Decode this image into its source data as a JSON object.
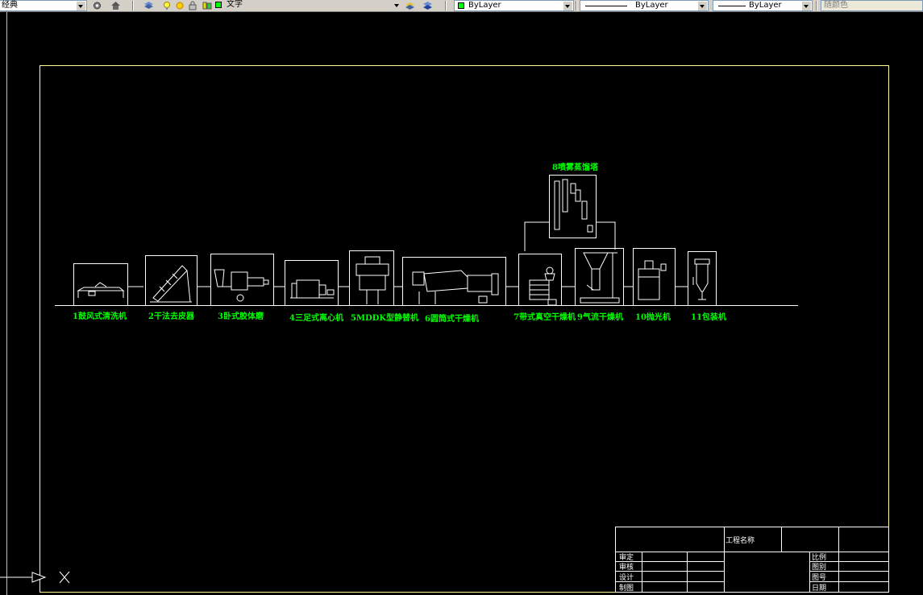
{
  "toolbar": {
    "style_combo": "经典",
    "text_style_combo": "文字",
    "color_combo": "ByLayer",
    "color_swatch": "#00ff00",
    "linetype_combo": "ByLayer",
    "lineweight_combo": "ByLayer",
    "plotstyle_combo": "随颜色",
    "icons": [
      "workspace-settings-icon",
      "workspace-home-icon",
      "layer-manager-icon",
      "layer-on-bulb-icon",
      "layer-freeze-sun-icon",
      "layer-lock-icon",
      "layer-color-icon",
      "layer-previous-icon",
      "layer-states-icon"
    ]
  },
  "drawing": {
    "colors": {
      "frame": "#ffff99",
      "lines": "#ffffff",
      "labels": "#00ff00"
    },
    "equipment": [
      {
        "id": "1",
        "label": "1鼓风式清洗机"
      },
      {
        "id": "2",
        "label": "2干法去皮器"
      },
      {
        "id": "3",
        "label": "3卧式胶体磨"
      },
      {
        "id": "4",
        "label": "4三足式离心机"
      },
      {
        "id": "5",
        "label": "5MDDK型静替机"
      },
      {
        "id": "6",
        "label": "6圆筒式干燥机"
      },
      {
        "id": "7",
        "label": "7带式真空干燥机"
      },
      {
        "id": "8",
        "label": "8喷雾蒸馏塔"
      },
      {
        "id": "9",
        "label": "9气流干燥机"
      },
      {
        "id": "10",
        "label": "10抛光机"
      },
      {
        "id": "11",
        "label": "11包装机"
      }
    ]
  },
  "title_block": {
    "project_name": "工程名称",
    "left_rows": [
      "审定",
      "审核",
      "设计",
      "制图"
    ],
    "right_rows": [
      "比例",
      "图别",
      "图号",
      "日期"
    ]
  },
  "ucs": {
    "axis_label": "X"
  }
}
